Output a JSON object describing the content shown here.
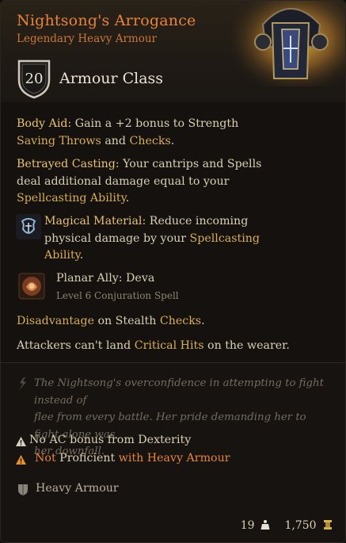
{
  "item": {
    "name": "Nightsong's Arrogance",
    "rarity_type": "Legendary Heavy Armour",
    "armour_class_value": "20",
    "armour_class_label": "Armour Class"
  },
  "properties": {
    "body_aid": {
      "name": "Body Aid:",
      "text1": " Gain a +2 bonus to Strength",
      "kw1": "Saving Throws",
      "text2": "  and ",
      "kw2": "Checks",
      "text3": "."
    },
    "betrayed_casting": {
      "name": "Betrayed Casting:",
      "text1": " Your cantrips and Spells",
      "text2": "deal additional damage equal to your",
      "kw1": "Spellcasting Ability",
      "text3": "."
    },
    "magical_material": {
      "name": "Magical Material:",
      "text1": " Reduce incoming",
      "text2": "physical damage by your ",
      "kw1": "Spellcasting",
      "kw2": "Ability",
      "text3": "."
    },
    "spell": {
      "name": "Planar Ally: Deva",
      "sub": "Level 6 Conjuration Spell"
    },
    "stealth": {
      "kw1": "Disadvantage",
      "text1": " on Stealth ",
      "kw2": "Checks",
      "text2": "."
    },
    "critical": {
      "text1": "Attackers can't land ",
      "kw1": "Critical Hits",
      "text2": " on the wearer."
    }
  },
  "flavor": {
    "line1": "The Nightsong's overconfidence in attempting to fight instead of",
    "line2": "flee from every battle. Her pride demanding her to fight alone was",
    "line3": "her downfall."
  },
  "warnings": {
    "dex": "No AC bonus from Dexterity",
    "prof_not": "Not",
    "prof_mid": " Proficient ",
    "prof_with": "with Heavy Armour"
  },
  "category": "Heavy Armour",
  "footer": {
    "weight": "19",
    "value": "1,750"
  },
  "colors": {
    "title": "#e8833b",
    "keyword": "#d7ad58",
    "text": "#d9cfb4",
    "background": "#14110e"
  },
  "icons": [
    "shield-icon",
    "magical-material-icon",
    "planar-ally-spell-icon",
    "flavor-quill-icon",
    "warning-icon",
    "heavy-armour-icon",
    "weight-icon",
    "gold-coin-icon"
  ]
}
